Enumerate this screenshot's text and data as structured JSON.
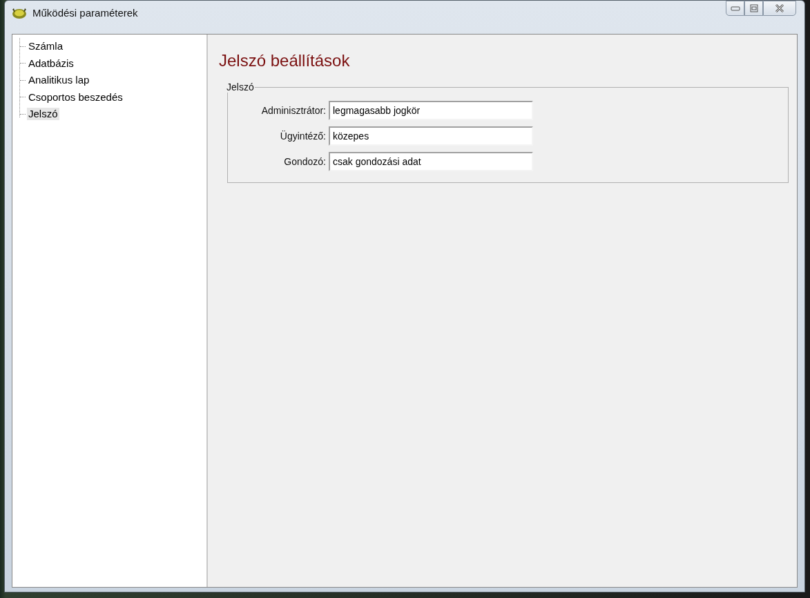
{
  "window": {
    "title": "Működési paraméterek"
  },
  "tree": {
    "items": [
      {
        "label": "Számla",
        "selected": false
      },
      {
        "label": "Adatbázis",
        "selected": false
      },
      {
        "label": "Analitikus lap",
        "selected": false
      },
      {
        "label": "Csoportos beszedés",
        "selected": false
      },
      {
        "label": "Jelszó",
        "selected": true
      }
    ]
  },
  "panel": {
    "heading": "Jelszó beállítások",
    "group": {
      "legend": "Jelszó",
      "fields": [
        {
          "label": "Adminisztrátor:",
          "value": "legmagasabb jogkör"
        },
        {
          "label": "Ügyintéző:",
          "value": "közepes"
        },
        {
          "label": "Gondozó:",
          "value": "csak gondozási adat"
        }
      ]
    }
  }
}
